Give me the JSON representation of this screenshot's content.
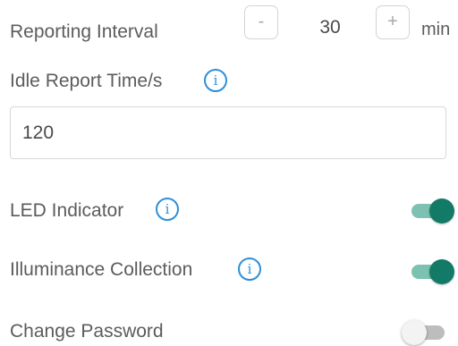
{
  "reporting_interval": {
    "label": "Reporting Interval",
    "decrement_label": "-",
    "value": "30",
    "increment_label": "+",
    "unit": "min"
  },
  "idle_report": {
    "label": "Idle Report Time/s",
    "info_icon": "info-icon",
    "value": "120"
  },
  "led_indicator": {
    "label": "LED Indicator",
    "info_icon": "info-icon",
    "enabled": true
  },
  "illuminance_collection": {
    "label": "Illuminance Collection",
    "info_icon": "info-icon",
    "enabled": true
  },
  "change_password": {
    "label": "Change Password",
    "enabled": false
  },
  "colors": {
    "accent": "#127a66",
    "accent_track": "#7cc1b1",
    "info": "#2f8fd8",
    "off_track": "#bdbdbd"
  }
}
